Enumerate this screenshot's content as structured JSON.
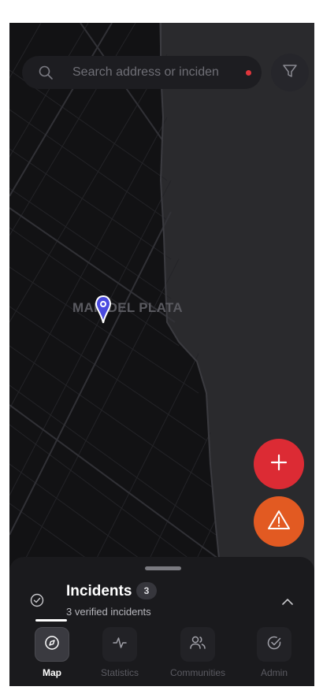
{
  "map": {
    "city_label": "MAR DEL PLATA",
    "pin_color": "#4a4ae0"
  },
  "search": {
    "placeholder": "Search address or inciden",
    "status_dot_color": "#e0363c"
  },
  "icons": {
    "search": "search-icon",
    "filter": "filter-icon",
    "add": "plus-icon",
    "alert": "warning-triangle-icon",
    "check": "check-circle-icon",
    "chevron": "chevron-up-icon",
    "map_tab": "compass-icon",
    "statistics_tab": "activity-icon",
    "communities_tab": "users-icon",
    "admin_tab": "check-circle-icon"
  },
  "fabs": {
    "add_color": "#dc2b34",
    "alert_color": "#e25a22"
  },
  "sheet": {
    "title": "Incidents",
    "count": "3",
    "subtitle": "3 verified incidents"
  },
  "tabs": [
    {
      "label": "Map",
      "active": true
    },
    {
      "label": "Statistics",
      "active": false
    },
    {
      "label": "Communities",
      "active": false
    },
    {
      "label": "Admin",
      "active": false
    }
  ]
}
